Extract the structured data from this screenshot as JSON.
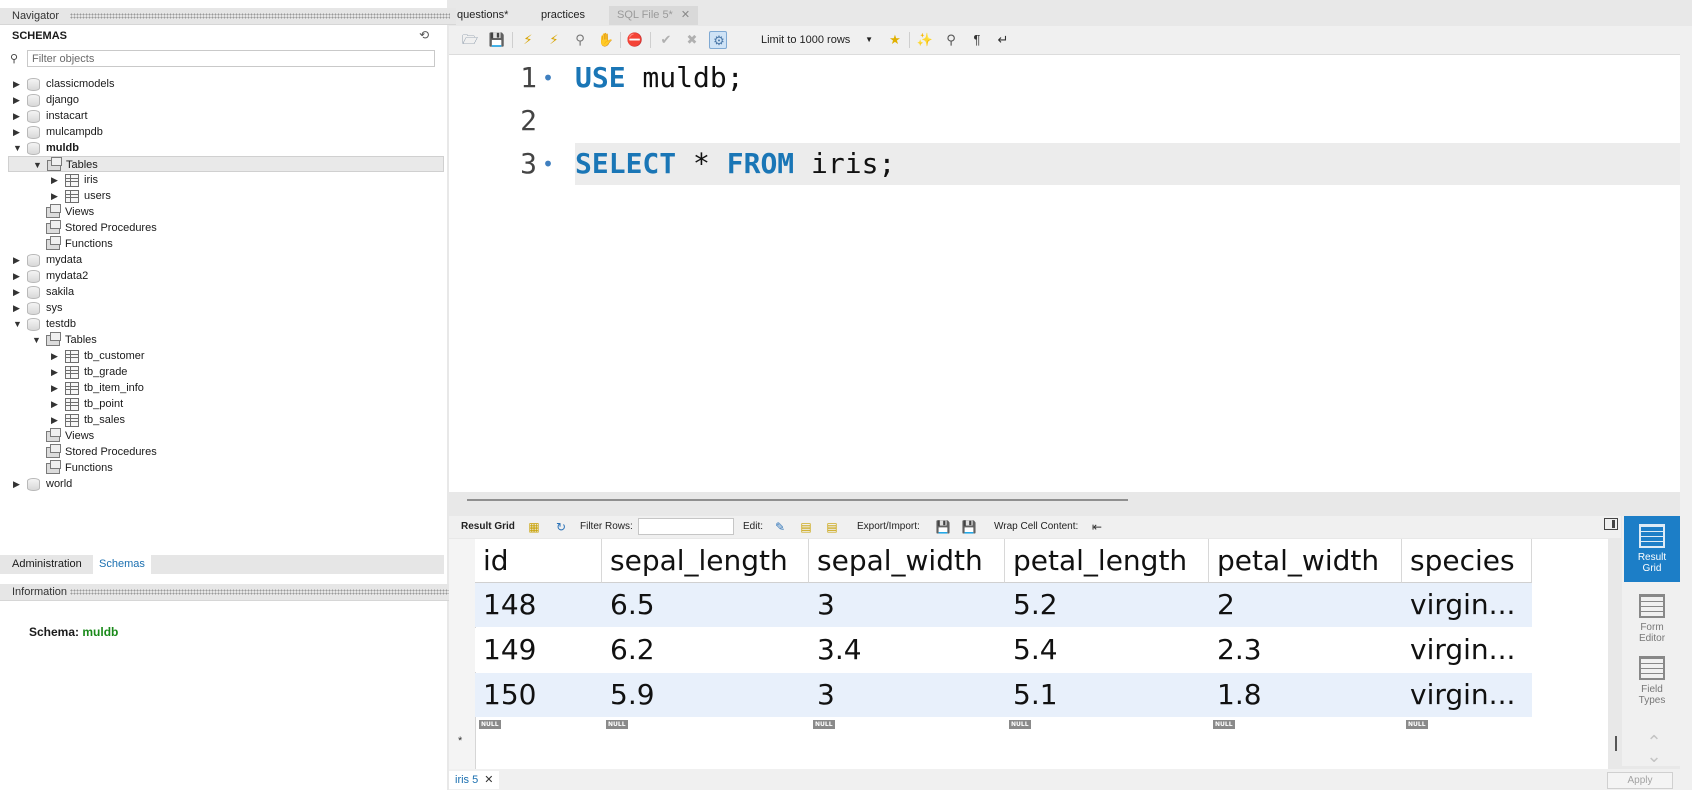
{
  "navigator": {
    "title": "Navigator",
    "schemas_label": "SCHEMAS",
    "filter_placeholder": "Filter objects",
    "tree": [
      {
        "label": "classicmodels",
        "kind": "db",
        "depth": 0,
        "expanded": false
      },
      {
        "label": "django",
        "kind": "db",
        "depth": 0,
        "expanded": false
      },
      {
        "label": "instacart",
        "kind": "db",
        "depth": 0,
        "expanded": false
      },
      {
        "label": "mulcampdb",
        "kind": "db",
        "depth": 0,
        "expanded": false
      },
      {
        "label": "muldb",
        "kind": "db",
        "depth": 0,
        "expanded": true,
        "bold": true
      },
      {
        "label": "Tables",
        "kind": "folder",
        "depth": 1,
        "expanded": true,
        "selected": true
      },
      {
        "label": "iris",
        "kind": "table",
        "depth": 2,
        "expanded": false
      },
      {
        "label": "users",
        "kind": "table",
        "depth": 2,
        "expanded": false
      },
      {
        "label": "Views",
        "kind": "folder",
        "depth": 1,
        "leaf": true
      },
      {
        "label": "Stored Procedures",
        "kind": "folder",
        "depth": 1,
        "leaf": true
      },
      {
        "label": "Functions",
        "kind": "folder",
        "depth": 1,
        "leaf": true
      },
      {
        "label": "mydata",
        "kind": "db",
        "depth": 0,
        "expanded": false
      },
      {
        "label": "mydata2",
        "kind": "db",
        "depth": 0,
        "expanded": false
      },
      {
        "label": "sakila",
        "kind": "db",
        "depth": 0,
        "expanded": false
      },
      {
        "label": "sys",
        "kind": "db",
        "depth": 0,
        "expanded": false
      },
      {
        "label": "testdb",
        "kind": "db",
        "depth": 0,
        "expanded": true
      },
      {
        "label": "Tables",
        "kind": "folder",
        "depth": 1,
        "expanded": true
      },
      {
        "label": "tb_customer",
        "kind": "table",
        "depth": 2,
        "expanded": false
      },
      {
        "label": "tb_grade",
        "kind": "table",
        "depth": 2,
        "expanded": false
      },
      {
        "label": "tb_item_info",
        "kind": "table",
        "depth": 2,
        "expanded": false
      },
      {
        "label": "tb_point",
        "kind": "table",
        "depth": 2,
        "expanded": false
      },
      {
        "label": "tb_sales",
        "kind": "table",
        "depth": 2,
        "expanded": false
      },
      {
        "label": "Views",
        "kind": "folder",
        "depth": 1,
        "leaf": true
      },
      {
        "label": "Stored Procedures",
        "kind": "folder",
        "depth": 1,
        "leaf": true
      },
      {
        "label": "Functions",
        "kind": "folder",
        "depth": 1,
        "leaf": true
      },
      {
        "label": "world",
        "kind": "db",
        "depth": 0,
        "expanded": false
      }
    ],
    "bottom_tabs": {
      "administration": "Administration",
      "schemas": "Schemas"
    },
    "info_title": "Information",
    "info_schema_key": "Schema:",
    "info_schema_value": "muldb"
  },
  "editor_tabs": [
    {
      "label": "questions*",
      "active": false
    },
    {
      "label": "practices",
      "active": false
    },
    {
      "label": "SQL File 5*",
      "active": true,
      "closable": true
    }
  ],
  "toolbar": {
    "limit_label": "Limit to 1000 rows"
  },
  "code_lines": [
    {
      "num": "1",
      "dot": true,
      "tokens": [
        {
          "t": "USE",
          "kw": true
        },
        {
          "t": " muldb;",
          "kw": false
        }
      ]
    },
    {
      "num": "2",
      "dot": false,
      "tokens": []
    },
    {
      "num": "3",
      "dot": true,
      "current": true,
      "tokens": [
        {
          "t": "SELECT",
          "kw": true
        },
        {
          "t": " * ",
          "kw": false
        },
        {
          "t": "FROM",
          "kw": true
        },
        {
          "t": " iris;",
          "kw": false
        }
      ]
    }
  ],
  "result_toolbar": {
    "result_grid": "Result Grid",
    "filter_rows": "Filter Rows:",
    "edit": "Edit:",
    "export_import": "Export/Import:",
    "wrap_cell": "Wrap Cell Content:"
  },
  "grid": {
    "columns": [
      "id",
      "sepal_length",
      "sepal_width",
      "petal_length",
      "petal_width",
      "species"
    ],
    "rows": [
      [
        "148",
        "6.5",
        "3",
        "5.2",
        "2",
        "virgin..."
      ],
      [
        "149",
        "6.2",
        "3.4",
        "5.4",
        "2.3",
        "virgin..."
      ],
      [
        "150",
        "5.9",
        "3",
        "5.1",
        "1.8",
        "virgin..."
      ]
    ],
    "null_label": "NULL",
    "new_row_marker": "*"
  },
  "side_panel": [
    {
      "label": "Result\nGrid",
      "active": true,
      "icon": "result-grid-icon"
    },
    {
      "label": "Form\nEditor",
      "active": false,
      "icon": "form-editor-icon"
    },
    {
      "label": "Field\nTypes",
      "active": false,
      "icon": "field-types-icon"
    }
  ],
  "status": {
    "result_tab": "iris 5",
    "apply": "Apply"
  },
  "colors": {
    "keyword": "#1a76b6",
    "schema_value": "#1a8a1a",
    "active_side": "#1c7ec7",
    "row_alt": "#e8f0fb"
  }
}
